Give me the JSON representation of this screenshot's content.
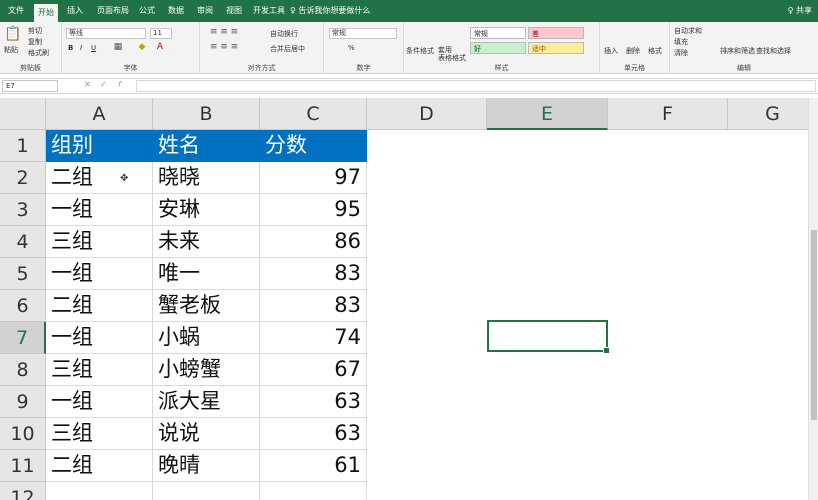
{
  "tabs": [
    "文件",
    "开始",
    "插入",
    "页面布局",
    "公式",
    "数据",
    "审阅",
    "视图",
    "开发工具"
  ],
  "active_tab": "开始",
  "tell_me": "♀ 告诉我你想要做什么",
  "share": "♀ 共享",
  "ribbon": {
    "clipboard": {
      "paste": "粘贴",
      "cut": "剪切",
      "copy": "复制",
      "format_painter": "格式刷",
      "label": "剪贴板"
    },
    "font": {
      "name": "等线",
      "size": "11",
      "label": "字体",
      "bold": "B",
      "italic": "I",
      "underline": "U"
    },
    "alignment": {
      "wrap": "自动换行",
      "merge": "合并后居中",
      "label": "对齐方式"
    },
    "number": {
      "format": "常规",
      "label": "数字",
      "percent": "%"
    },
    "styles": {
      "conditional": "条件格式",
      "table": "套用\n表格格式",
      "normal": "常规",
      "bad": "差",
      "good": "好",
      "neutral": "适中",
      "label": "样式"
    },
    "cells": {
      "insert": "插入",
      "delete": "删除",
      "format": "格式",
      "label": "单元格"
    },
    "editing": {
      "autosum": "自动求和",
      "fill": "填充",
      "clear": "清除",
      "sort": "排序和筛选",
      "find": "查找和选择",
      "label": "编辑"
    }
  },
  "name_box": "E7",
  "columns": [
    "A",
    "B",
    "C",
    "D",
    "E",
    "F",
    "G"
  ],
  "selected_column": "E",
  "selected_row": 7,
  "rows": [
    [
      "组别",
      "姓名",
      "分数"
    ],
    [
      "二组",
      "晓晓",
      "97"
    ],
    [
      "一组",
      "安琳",
      "95"
    ],
    [
      "三组",
      "未来",
      "86"
    ],
    [
      "一组",
      "唯一",
      "83"
    ],
    [
      "二组",
      "蟹老板",
      "83"
    ],
    [
      "一组",
      "小蜗",
      "74"
    ],
    [
      "三组",
      "小螃蟹",
      "67"
    ],
    [
      "一组",
      "派大星",
      "63"
    ],
    [
      "三组",
      "说说",
      "63"
    ],
    [
      "二组",
      "晚晴",
      "61"
    ]
  ],
  "row_numbers": [
    "1",
    "2",
    "3",
    "4",
    "5",
    "6",
    "7",
    "8",
    "9",
    "10",
    "11",
    "12"
  ],
  "colors": {
    "ribbon_green": "#217346",
    "header_fill": "#0070c0",
    "bad_fill": "#ffc7ce",
    "good_fill": "#c6efce",
    "neutral_fill": "#ffeb9c"
  }
}
